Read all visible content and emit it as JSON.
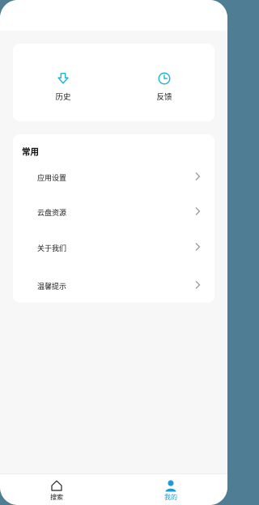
{
  "colors": {
    "accent": "#1e9ad6",
    "icon_cyan": "#20b6d3",
    "text": "#222222",
    "chevron": "#9a9a9a"
  },
  "quick_actions": [
    {
      "label": "历史",
      "icon": "download-arrow-icon"
    },
    {
      "label": "反馈",
      "icon": "clock-icon"
    }
  ],
  "common": {
    "title": "常用",
    "items": [
      {
        "label": "应用设置"
      },
      {
        "label": "云盘资源"
      },
      {
        "label": "关于我们"
      },
      {
        "label": "温馨提示"
      }
    ]
  },
  "tabbar": {
    "tabs": [
      {
        "label": "搜索",
        "icon": "home-icon",
        "active": false
      },
      {
        "label": "我的",
        "icon": "user-icon",
        "active": true
      }
    ]
  }
}
